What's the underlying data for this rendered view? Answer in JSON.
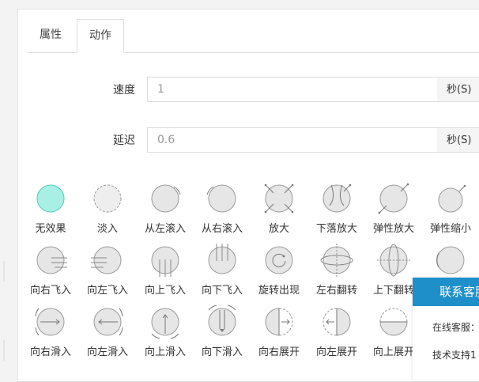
{
  "tabs": [
    {
      "label": "属性",
      "active": false
    },
    {
      "label": "动作",
      "active": true
    }
  ],
  "speed": {
    "label": "速度",
    "value": "1",
    "unit": "秒(S)"
  },
  "delay": {
    "label": "延迟",
    "value": "0.6",
    "unit": "秒(S)"
  },
  "effects": [
    {
      "label": "无效果",
      "icon": "no-effect-icon",
      "selected": true
    },
    {
      "label": "淡入",
      "icon": "fade-in-icon"
    },
    {
      "label": "从左滚入",
      "icon": "roll-from-left-icon"
    },
    {
      "label": "从右滚入",
      "icon": "roll-from-right-icon"
    },
    {
      "label": "放大",
      "icon": "zoom-in-icon"
    },
    {
      "label": "下落放大",
      "icon": "drop-zoom-icon"
    },
    {
      "label": "弹性放大",
      "icon": "elastic-zoom-in-icon"
    },
    {
      "label": "弹性缩小",
      "icon": "elastic-zoom-out-icon"
    },
    {
      "label": "向右飞入",
      "icon": "fly-in-right-icon"
    },
    {
      "label": "向左飞入",
      "icon": "fly-in-left-icon"
    },
    {
      "label": "向上飞入",
      "icon": "fly-in-up-icon"
    },
    {
      "label": "向下飞入",
      "icon": "fly-in-down-icon"
    },
    {
      "label": "旋转出现",
      "icon": "rotate-in-icon"
    },
    {
      "label": "左右翻转",
      "icon": "flip-horizontal-icon"
    },
    {
      "label": "上下翻转",
      "icon": "flip-vertical-icon"
    },
    {
      "label": "",
      "icon": "more-effect-icon"
    },
    {
      "label": "向右滑入",
      "icon": "slide-in-right-icon"
    },
    {
      "label": "向左滑入",
      "icon": "slide-in-left-icon"
    },
    {
      "label": "向上滑入",
      "icon": "slide-in-up-icon"
    },
    {
      "label": "向下滑入",
      "icon": "slide-in-down-icon"
    },
    {
      "label": "向右展开",
      "icon": "expand-right-icon"
    },
    {
      "label": "向左展开",
      "icon": "expand-left-icon"
    },
    {
      "label": "向上展开",
      "icon": "expand-up-icon"
    }
  ],
  "contact": {
    "title": "联系客服",
    "lines": [
      "在线客服：",
      "技术支持1"
    ]
  },
  "colors": {
    "accent": "#1e8fc8",
    "selected_fill": "#a8f0e6"
  }
}
